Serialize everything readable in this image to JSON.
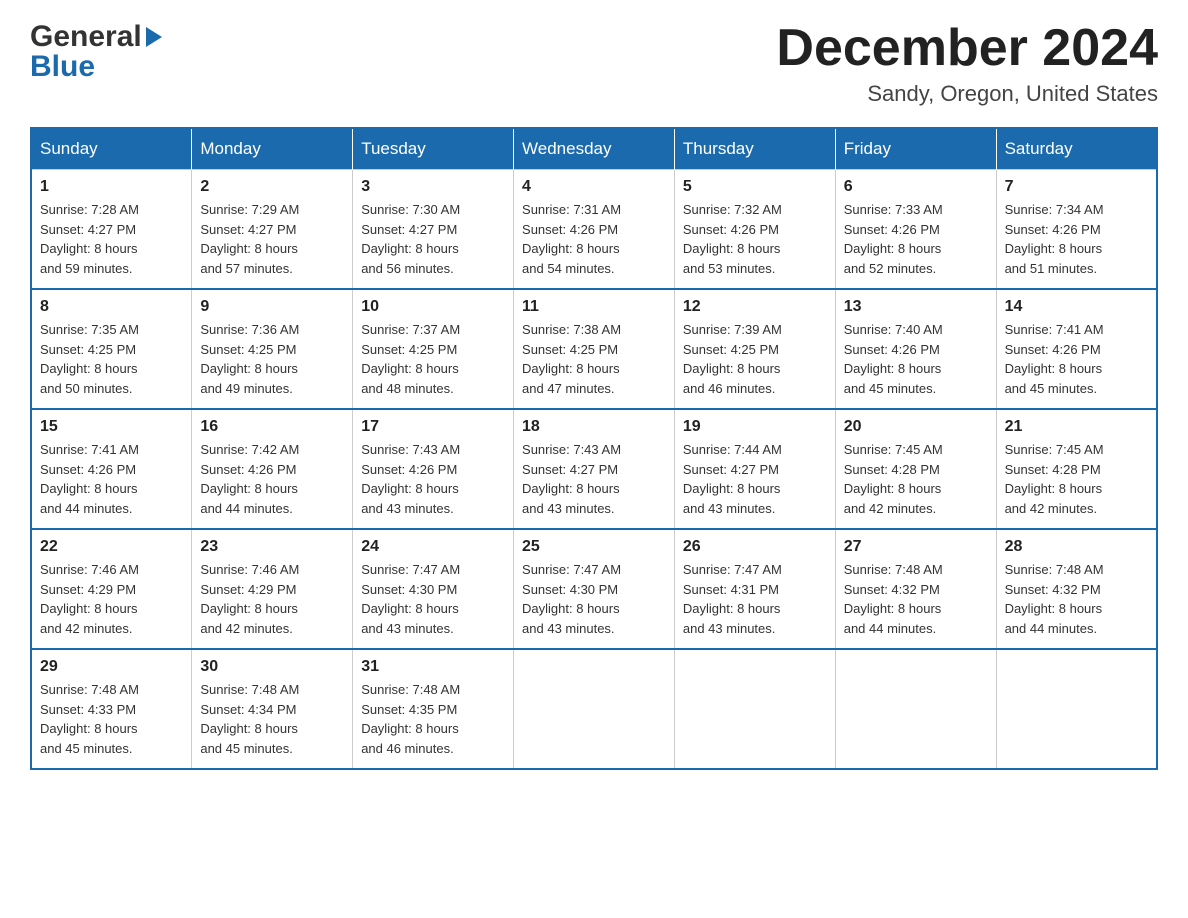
{
  "header": {
    "logo_general": "General",
    "logo_blue": "Blue",
    "month": "December 2024",
    "location": "Sandy, Oregon, United States"
  },
  "days_of_week": [
    "Sunday",
    "Monday",
    "Tuesday",
    "Wednesday",
    "Thursday",
    "Friday",
    "Saturday"
  ],
  "weeks": [
    [
      {
        "day": "1",
        "sunrise": "7:28 AM",
        "sunset": "4:27 PM",
        "daylight": "8 hours and 59 minutes."
      },
      {
        "day": "2",
        "sunrise": "7:29 AM",
        "sunset": "4:27 PM",
        "daylight": "8 hours and 57 minutes."
      },
      {
        "day": "3",
        "sunrise": "7:30 AM",
        "sunset": "4:27 PM",
        "daylight": "8 hours and 56 minutes."
      },
      {
        "day": "4",
        "sunrise": "7:31 AM",
        "sunset": "4:26 PM",
        "daylight": "8 hours and 54 minutes."
      },
      {
        "day": "5",
        "sunrise": "7:32 AM",
        "sunset": "4:26 PM",
        "daylight": "8 hours and 53 minutes."
      },
      {
        "day": "6",
        "sunrise": "7:33 AM",
        "sunset": "4:26 PM",
        "daylight": "8 hours and 52 minutes."
      },
      {
        "day": "7",
        "sunrise": "7:34 AM",
        "sunset": "4:26 PM",
        "daylight": "8 hours and 51 minutes."
      }
    ],
    [
      {
        "day": "8",
        "sunrise": "7:35 AM",
        "sunset": "4:25 PM",
        "daylight": "8 hours and 50 minutes."
      },
      {
        "day": "9",
        "sunrise": "7:36 AM",
        "sunset": "4:25 PM",
        "daylight": "8 hours and 49 minutes."
      },
      {
        "day": "10",
        "sunrise": "7:37 AM",
        "sunset": "4:25 PM",
        "daylight": "8 hours and 48 minutes."
      },
      {
        "day": "11",
        "sunrise": "7:38 AM",
        "sunset": "4:25 PM",
        "daylight": "8 hours and 47 minutes."
      },
      {
        "day": "12",
        "sunrise": "7:39 AM",
        "sunset": "4:25 PM",
        "daylight": "8 hours and 46 minutes."
      },
      {
        "day": "13",
        "sunrise": "7:40 AM",
        "sunset": "4:26 PM",
        "daylight": "8 hours and 45 minutes."
      },
      {
        "day": "14",
        "sunrise": "7:41 AM",
        "sunset": "4:26 PM",
        "daylight": "8 hours and 45 minutes."
      }
    ],
    [
      {
        "day": "15",
        "sunrise": "7:41 AM",
        "sunset": "4:26 PM",
        "daylight": "8 hours and 44 minutes."
      },
      {
        "day": "16",
        "sunrise": "7:42 AM",
        "sunset": "4:26 PM",
        "daylight": "8 hours and 44 minutes."
      },
      {
        "day": "17",
        "sunrise": "7:43 AM",
        "sunset": "4:26 PM",
        "daylight": "8 hours and 43 minutes."
      },
      {
        "day": "18",
        "sunrise": "7:43 AM",
        "sunset": "4:27 PM",
        "daylight": "8 hours and 43 minutes."
      },
      {
        "day": "19",
        "sunrise": "7:44 AM",
        "sunset": "4:27 PM",
        "daylight": "8 hours and 43 minutes."
      },
      {
        "day": "20",
        "sunrise": "7:45 AM",
        "sunset": "4:28 PM",
        "daylight": "8 hours and 42 minutes."
      },
      {
        "day": "21",
        "sunrise": "7:45 AM",
        "sunset": "4:28 PM",
        "daylight": "8 hours and 42 minutes."
      }
    ],
    [
      {
        "day": "22",
        "sunrise": "7:46 AM",
        "sunset": "4:29 PM",
        "daylight": "8 hours and 42 minutes."
      },
      {
        "day": "23",
        "sunrise": "7:46 AM",
        "sunset": "4:29 PM",
        "daylight": "8 hours and 42 minutes."
      },
      {
        "day": "24",
        "sunrise": "7:47 AM",
        "sunset": "4:30 PM",
        "daylight": "8 hours and 43 minutes."
      },
      {
        "day": "25",
        "sunrise": "7:47 AM",
        "sunset": "4:30 PM",
        "daylight": "8 hours and 43 minutes."
      },
      {
        "day": "26",
        "sunrise": "7:47 AM",
        "sunset": "4:31 PM",
        "daylight": "8 hours and 43 minutes."
      },
      {
        "day": "27",
        "sunrise": "7:48 AM",
        "sunset": "4:32 PM",
        "daylight": "8 hours and 44 minutes."
      },
      {
        "day": "28",
        "sunrise": "7:48 AM",
        "sunset": "4:32 PM",
        "daylight": "8 hours and 44 minutes."
      }
    ],
    [
      {
        "day": "29",
        "sunrise": "7:48 AM",
        "sunset": "4:33 PM",
        "daylight": "8 hours and 45 minutes."
      },
      {
        "day": "30",
        "sunrise": "7:48 AM",
        "sunset": "4:34 PM",
        "daylight": "8 hours and 45 minutes."
      },
      {
        "day": "31",
        "sunrise": "7:48 AM",
        "sunset": "4:35 PM",
        "daylight": "8 hours and 46 minutes."
      },
      null,
      null,
      null,
      null
    ]
  ],
  "labels": {
    "sunrise": "Sunrise:",
    "sunset": "Sunset:",
    "daylight": "Daylight:"
  }
}
